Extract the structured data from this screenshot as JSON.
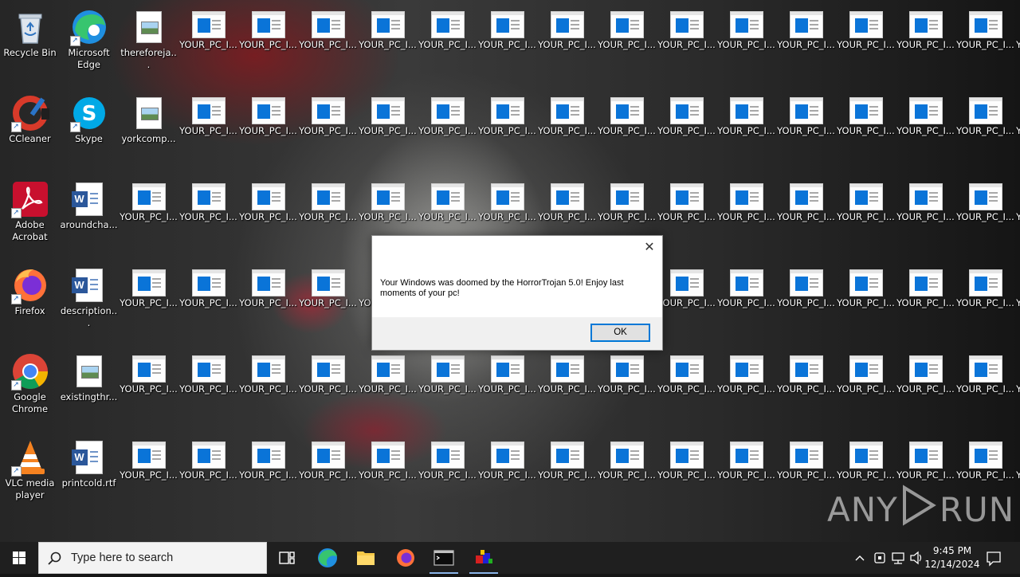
{
  "desktop": {
    "left_icons": [
      {
        "label": "Recycle Bin",
        "icon": "recycle-bin-icon"
      },
      {
        "label": "Microsoft Edge",
        "icon": "edge-icon"
      },
      {
        "label": "thereforeja...",
        "icon": "image-file-icon"
      },
      {
        "label": "CCleaner",
        "icon": "ccleaner-icon"
      },
      {
        "label": "Skype",
        "icon": "skype-icon"
      },
      {
        "label": "yorkcomp...",
        "icon": "image-file-icon"
      },
      {
        "label": "Adobe Acrobat",
        "icon": "acrobat-icon"
      },
      {
        "label": "aroundcha...",
        "icon": "word-document-icon"
      },
      {
        "label": "Firefox",
        "icon": "firefox-icon"
      },
      {
        "label": "description...",
        "icon": "word-document-icon"
      },
      {
        "label": "Google Chrome",
        "icon": "chrome-icon"
      },
      {
        "label": "existingthr...",
        "icon": "image-file-icon"
      },
      {
        "label": "VLC media player",
        "icon": "vlc-icon"
      },
      {
        "label": "printcold.rtf",
        "icon": "word-document-icon"
      }
    ],
    "generated_icon_label": "YOUR_PC_I..."
  },
  "dialog": {
    "message": "Your Windows was doomed by the HorrorTrojan 5.0! Enjoy last moments of your pc!",
    "ok_label": "OK",
    "close_glyph": "✕"
  },
  "watermark": {
    "left": "ANY",
    "right": "RUN"
  },
  "taskbar": {
    "search_placeholder": "Type here to search",
    "apps": [
      "task-view",
      "edge",
      "file-explorer",
      "firefox",
      "command-prompt",
      "trojan-app"
    ],
    "clock_time": "9:45 PM",
    "clock_date": "12/14/2024"
  }
}
